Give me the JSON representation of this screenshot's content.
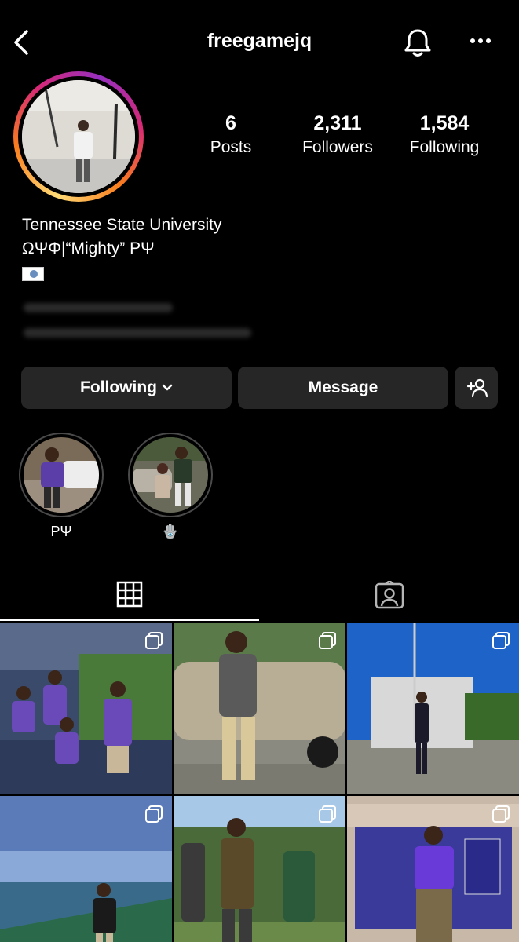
{
  "header": {
    "username": "freegamejq",
    "back_icon": "chevron-left-icon",
    "bell_icon": "bell-icon",
    "more_icon": "more-horizontal-icon"
  },
  "stats": {
    "posts_count": "6",
    "posts_label": "Posts",
    "followers_count": "2,311",
    "followers_label": "Followers",
    "following_count": "1,584",
    "following_label": "Following"
  },
  "bio": {
    "line1": "Tennessee State University",
    "line2": "ΩΨΦ|“Mighty” ΡΨ"
  },
  "actions": {
    "following_label": "Following",
    "message_label": "Message",
    "add_user_icon": "add-user-icon"
  },
  "highlights": [
    {
      "label": "ΡΨ"
    },
    {
      "label": "🪬"
    }
  ],
  "tabs": {
    "grid_icon": "grid-icon",
    "tagged_icon": "tagged-icon"
  },
  "colors": {
    "background": "#000000",
    "button_bg": "#262626",
    "text": "#ffffff"
  }
}
